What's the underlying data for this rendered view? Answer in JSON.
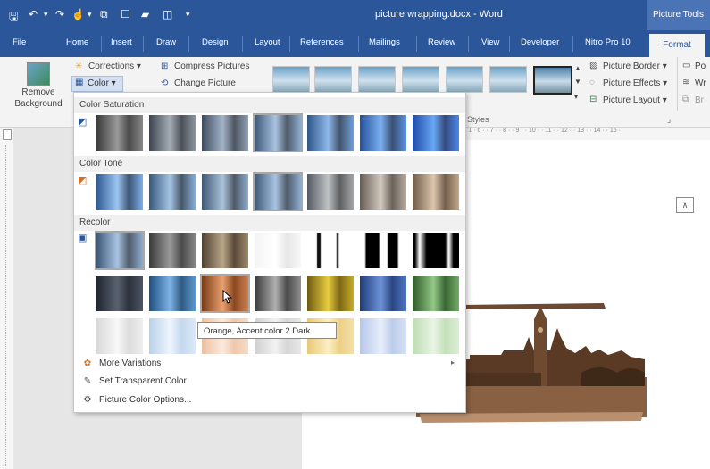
{
  "titlebar": {
    "document_title": "picture wrapping.docx - Word",
    "context_title": "Picture Tools",
    "quick_access": [
      "save-icon",
      "undo-icon",
      "redo-icon",
      "touch-icon",
      "shapes-icon",
      "page-icon",
      "picture-icon",
      "window-icon",
      "customize-icon"
    ]
  },
  "tabs": [
    {
      "label": "File"
    },
    {
      "label": "Home"
    },
    {
      "label": "Insert"
    },
    {
      "label": "Draw"
    },
    {
      "label": "Design"
    },
    {
      "label": "Layout"
    },
    {
      "label": "References"
    },
    {
      "label": "Mailings"
    },
    {
      "label": "Review"
    },
    {
      "label": "View"
    },
    {
      "label": "Developer"
    },
    {
      "label": "Nitro Pro 10"
    },
    {
      "label": "Format"
    }
  ],
  "ribbon": {
    "remove_background_line1": "Remove",
    "remove_background_line2": "Background",
    "corrections": "Corrections ▾",
    "color": "Color ▾",
    "compress": "Compress Pictures",
    "change": "Change Picture",
    "picture_border": "Picture Border ▾",
    "picture_effects": "Picture Effects ▾",
    "picture_layout": "Picture Layout ▾",
    "styles_label": "Styles",
    "pos_partial": "Po",
    "wr_partial": "Wr",
    "br_partial": "Br"
  },
  "color_menu": {
    "saturation_header": "Color Saturation",
    "tone_header": "Color Tone",
    "recolor_header": "Recolor",
    "more_variations": "More Variations",
    "set_transparent": "Set Transparent Color",
    "color_options": "Picture Color Options...",
    "tooltip": "Orange, Accent color 2 Dark"
  },
  "ruler_text": "· 1 · 6 · · 7 · · 8 · · 9 · · 10 · · 11 · · 12 · · 13 · · 14 · · 15 ·",
  "colors": {
    "word_blue": "#2b579a",
    "ribbon_bg": "#f3f3f3",
    "sepia": "#7b5538"
  }
}
